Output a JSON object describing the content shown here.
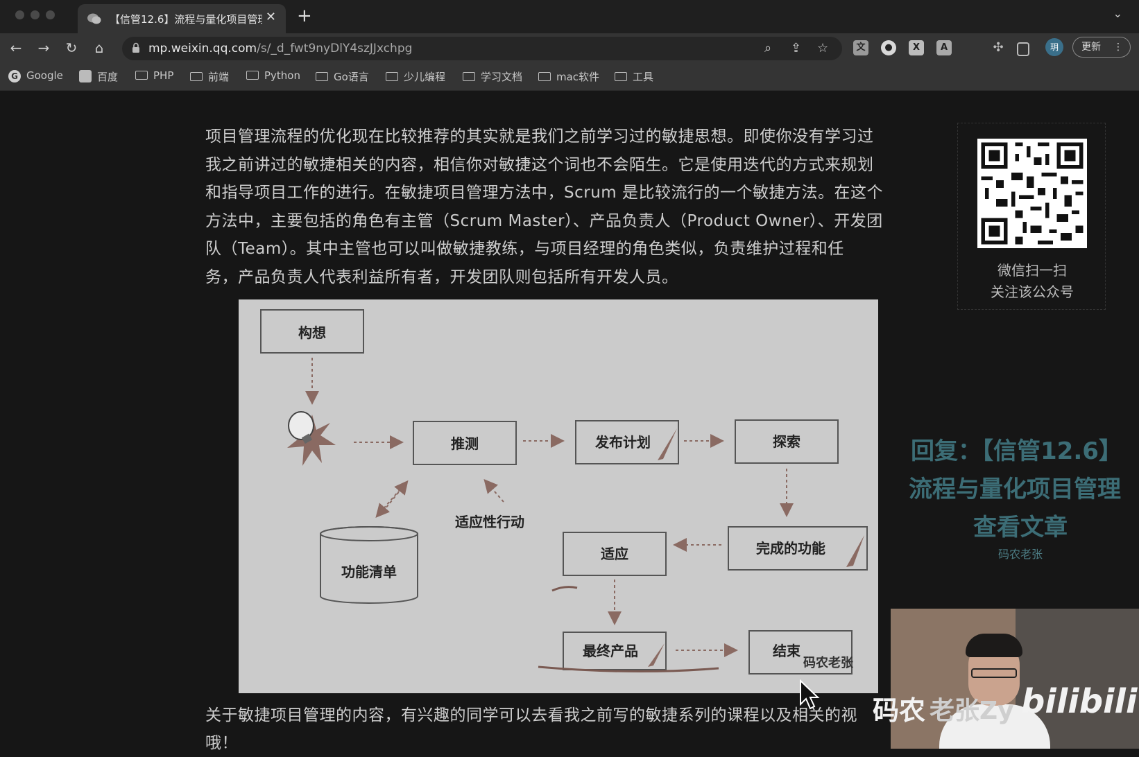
{
  "browser": {
    "tab_title": "【信管12.6】流程与量化项目管理",
    "tab_close": "✕",
    "new_tab": "+",
    "url_host": "mp.weixin.qq.com",
    "url_path": "/s/_d_fwt9nyDlY4szJJxchpg",
    "update_label": "更新",
    "avatar_label": "玥",
    "bookmarks": [
      "Google",
      "百度",
      "PHP",
      "前端",
      "Python",
      "Go语言",
      "少儿编程",
      "学习文档",
      "mac软件",
      "工具"
    ]
  },
  "article": {
    "paragraph_lines": [
      "项目管理流程的优化现在比较推荐的其实就是我们之前学习过的敏捷思想。即使你没有学习过",
      "我之前讲过的敏捷相关的内容，相信你对敏捷这个词也不会陌生。它是使用迭代的方式来规划",
      "和指导项目工作的进行。在敏捷项目管理方法中，Scrum 是比较流行的一个敏捷方法。在这个",
      "方法中，主要包括的角色有主管（Scrum Master）、产品负责人（Product Owner）、开发团",
      "队（Team）。其中主管也可以叫做敏捷教练，与项目经理的角色类似，负责维护过程和任",
      "务，产品负责人代表利益所有者，开发团队则包括所有开发人员。"
    ],
    "below_lines": [
      "关于敏捷项目管理的内容，有兴趣的同学可以去看我之前写的敏捷系列的课程以及相关的视",
      "哦！"
    ]
  },
  "diagram": {
    "nodes": {
      "envision": "构想",
      "speculate": "推测",
      "release_plan": "发布计划",
      "explore": "探索",
      "completed_features": "完成的功能",
      "adapt": "适应",
      "feature_list": "功能清单",
      "final_product": "最终产品",
      "close": "结束"
    },
    "edge_label": "适应性行动",
    "watermark": "码农老张"
  },
  "sidebar": {
    "qr_caption_1": "微信扫一扫",
    "qr_caption_2": "关注该公众号"
  },
  "overlay": {
    "reply_line1": "回复：【信管12.6】",
    "reply_line2": "流程与量化项目管理",
    "reply_line3": "查看文章",
    "reply_author": "码农老张"
  },
  "video_watermark": {
    "text1": "码农",
    "text2": "老张Zy",
    "logo": "bilibili"
  }
}
